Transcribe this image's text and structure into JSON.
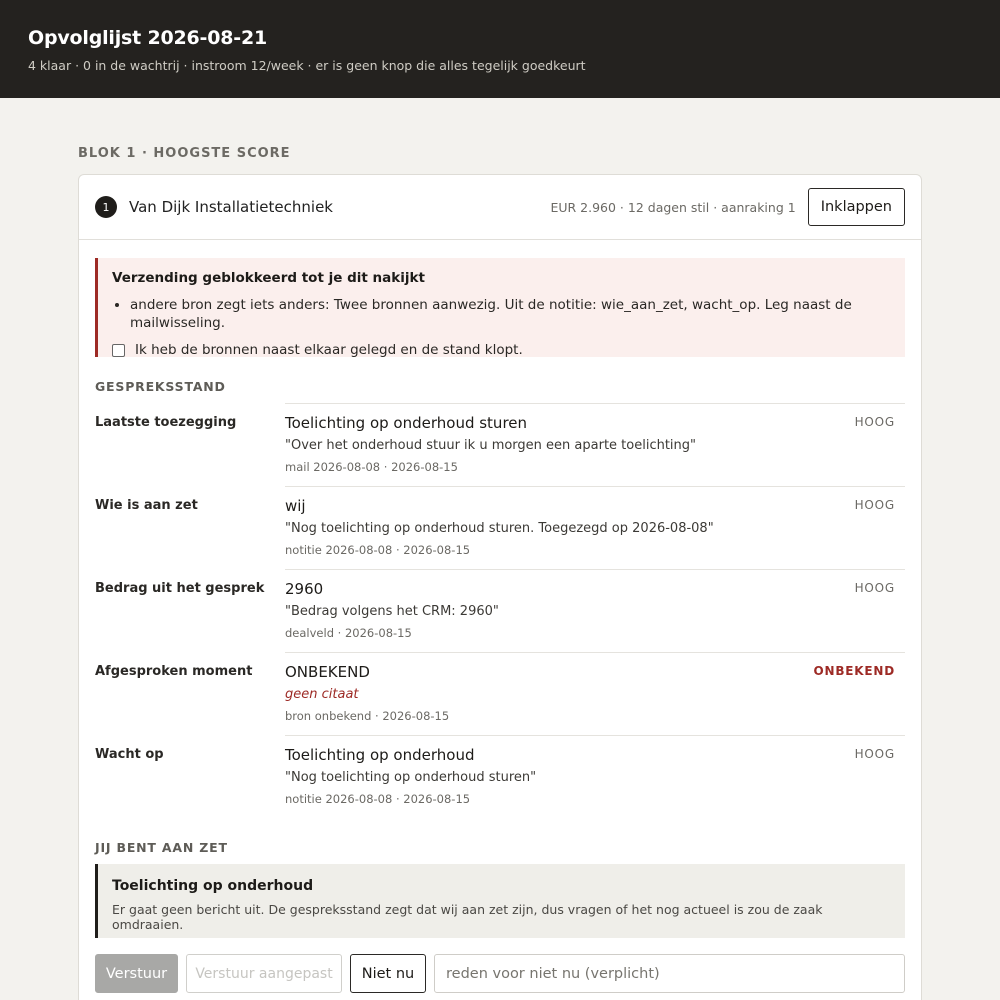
{
  "header": {
    "title": "Opvolglijst 2026-08-21",
    "subtitle": "4 klaar · 0 in de wachtrij · instroom 12/week · er is geen knop die alles tegelijk goedkeurt"
  },
  "block_label": "BLOK 1 · HOOGSTE SCORE",
  "card": {
    "rank": "1",
    "company": "Van Dijk Installatietechniek",
    "meta": "EUR 2.960 · 12 dagen stil · aanraking 1",
    "collapse_label": "Inklappen",
    "alert": {
      "title": "Verzending geblokkeerd tot je dit nakijkt",
      "items": [
        "andere bron zegt iets anders: Twee bronnen aanwezig. Uit de notitie: wie_aan_zet, wacht_op. Leg naast de mailwisseling."
      ],
      "check_label": "Ik heb de bronnen naast elkaar gelegd en de stand klopt."
    },
    "state_heading": "GESPREKSSTAND",
    "rows": [
      {
        "label": "Laatste toezegging",
        "value": "Toelichting op onderhoud sturen",
        "quote": "\"Over het onderhoud stuur ik u morgen een aparte toelichting\"",
        "source": "mail 2026-08-08 · 2026-08-15",
        "badge": "HOOG"
      },
      {
        "label": "Wie is aan zet",
        "value": "wij",
        "quote": "\"Nog toelichting op onderhoud sturen. Toegezegd op 2026-08-08\"",
        "source": "notitie 2026-08-08 · 2026-08-15",
        "badge": "HOOG"
      },
      {
        "label": "Bedrag uit het gesprek",
        "value": "2960",
        "quote": "\"Bedrag volgens het CRM: 2960\"",
        "source": "dealveld · 2026-08-15",
        "badge": "HOOG"
      },
      {
        "label": "Afgesproken moment",
        "value": "ONBEKEND",
        "quote": "geen citaat",
        "source": "bron onbekend · 2026-08-15",
        "badge": "ONBEKEND"
      },
      {
        "label": "Wacht op",
        "value": "Toelichting op onderhoud",
        "quote": "\"Nog toelichting op onderhoud sturen\"",
        "source": "notitie 2026-08-08 · 2026-08-15",
        "badge": "HOOG"
      }
    ],
    "turn_heading": "JIJ BENT AAN ZET",
    "turn": {
      "title": "Toelichting op onderhoud",
      "text": "Er gaat geen bericht uit. De gespreksstand zegt dat wij aan zet zijn, dus vragen of het nog actueel is zou de zaak omdraaien."
    },
    "actions": {
      "send": "Verstuur",
      "send_adjusted": "Verstuur aangepast",
      "not_now": "Niet nu",
      "reason_placeholder": "reden voor niet nu (verplicht)"
    }
  },
  "colors": {
    "header_bg": "#24221f",
    "page_bg": "#f3f2ee",
    "alert_accent": "#9d2a25",
    "alert_bg": "#fbefed"
  }
}
